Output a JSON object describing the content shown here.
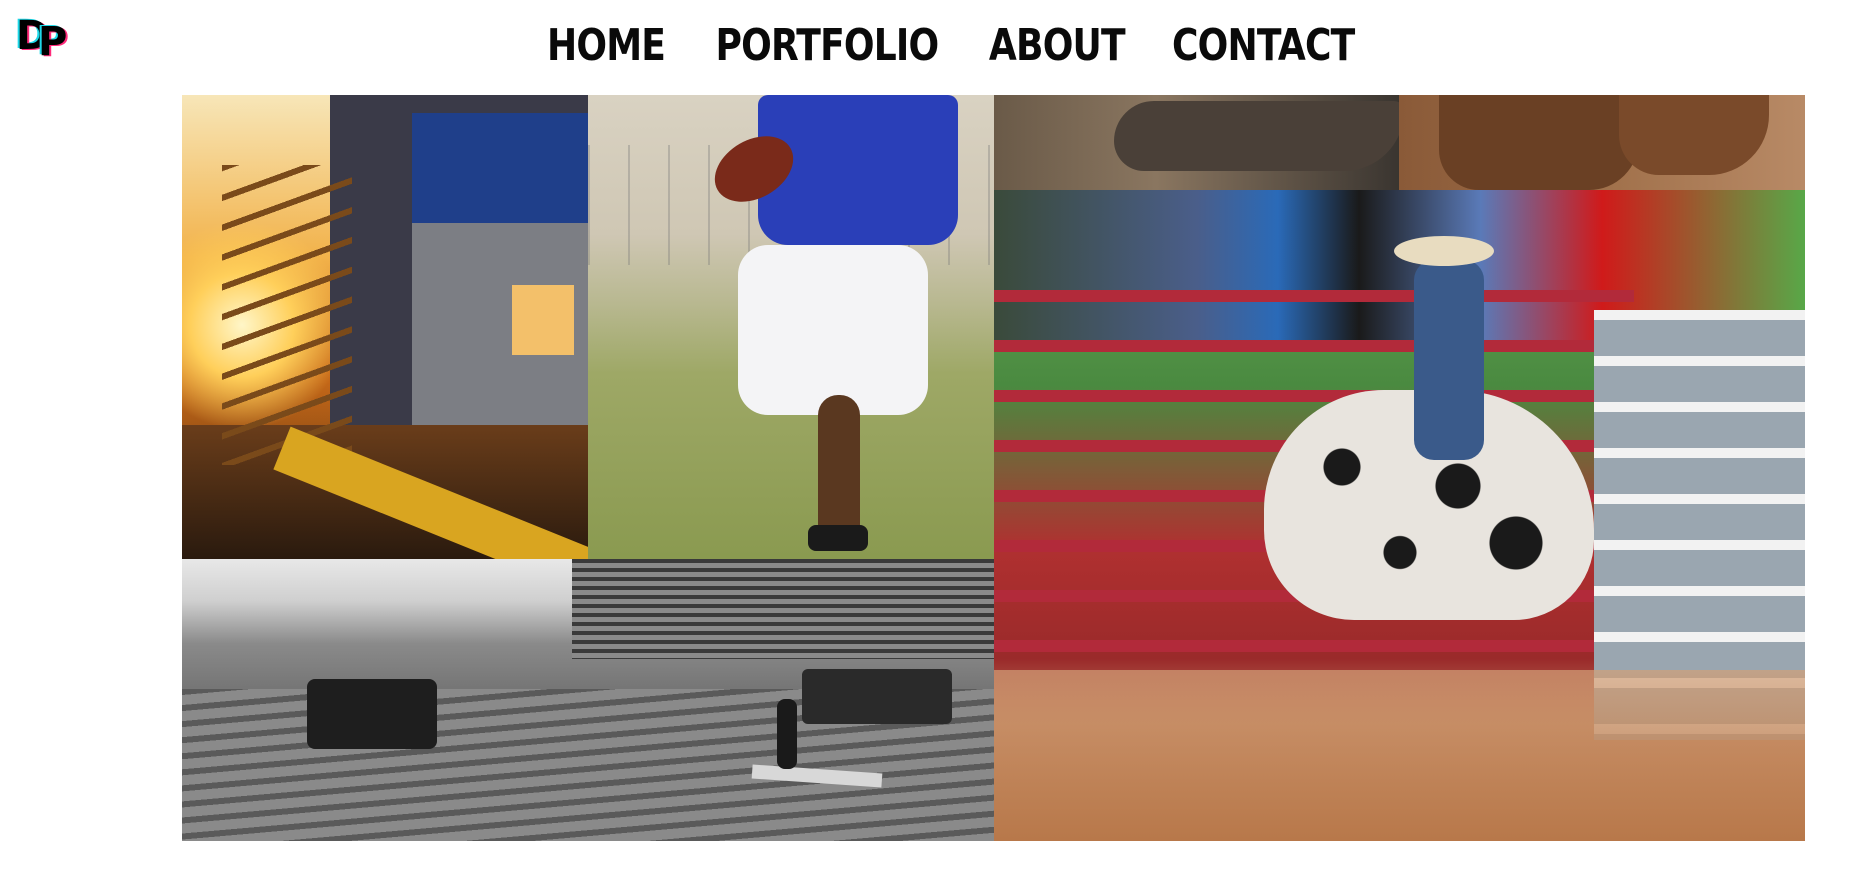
{
  "logo": {
    "letter_1": "D",
    "letter_2": "P"
  },
  "nav": {
    "items": [
      {
        "label": "HOME"
      },
      {
        "label": "PORTFOLIO"
      },
      {
        "label": "ABOUT"
      },
      {
        "label": "CONTACT"
      }
    ]
  },
  "gallery": {
    "tiles": [
      {
        "subject": "sunset-bleachers-stairs"
      },
      {
        "subject": "football-player-running"
      },
      {
        "subject": "ostrich-beak"
      },
      {
        "subject": "antelope-herd"
      },
      {
        "subject": "rodeo-bull-rider"
      },
      {
        "subject": "mud-truck-race"
      }
    ]
  },
  "colors": {
    "logo_shadow_pink": "#ff2a7a",
    "logo_shadow_cyan": "#1ed8e8",
    "nav_text": "#0a0a0a",
    "background": "#ffffff"
  }
}
